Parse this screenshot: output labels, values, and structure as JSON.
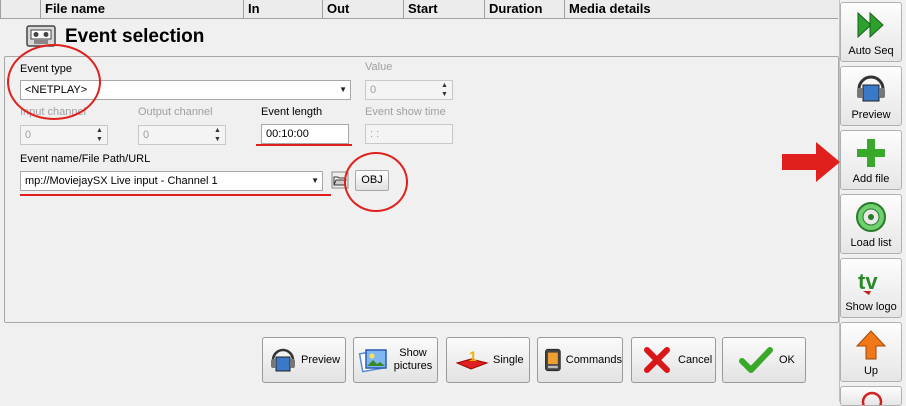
{
  "grid": {
    "columns": [
      "File name",
      "In",
      "Out",
      "Start",
      "Duration",
      "Media details"
    ]
  },
  "dialog": {
    "title": "Event selection",
    "event_type_label": "Event type",
    "event_type_value": "<NETPLAY>",
    "value_label": "Value",
    "value_value": "0",
    "input_channel_label": "Input channel",
    "input_channel_value": "0",
    "output_channel_label": "Output channel",
    "output_channel_value": "0",
    "event_length_label": "Event length",
    "event_length_value": "00:10:00",
    "event_show_time_label": "Event show time",
    "event_show_time_value": " :  :",
    "event_name_label": "Event name/File Path/URL",
    "event_name_value": "mp://MoviejaySX Live input - Channel 1",
    "obj_label": "OBJ"
  },
  "buttons": {
    "preview": "Preview",
    "show_pictures": "Show pictures",
    "single": "Single",
    "commands": "Commands",
    "cancel": "Cancel",
    "ok": "OK"
  },
  "toolbar": {
    "items": [
      {
        "label": "Auto  Seq",
        "icon": "fast-forward-icon"
      },
      {
        "label": "Preview",
        "icon": "film-headphones-icon"
      },
      {
        "label": "Add file",
        "icon": "plus-icon"
      },
      {
        "label": "Load list",
        "icon": "disc-icon"
      },
      {
        "label": "Show logo",
        "icon": "tv-logo-icon"
      },
      {
        "label": "Up",
        "icon": "arrow-up-icon"
      }
    ]
  },
  "colors": {
    "annotation_red": "#e0201c",
    "add_green": "#3aa82a"
  }
}
